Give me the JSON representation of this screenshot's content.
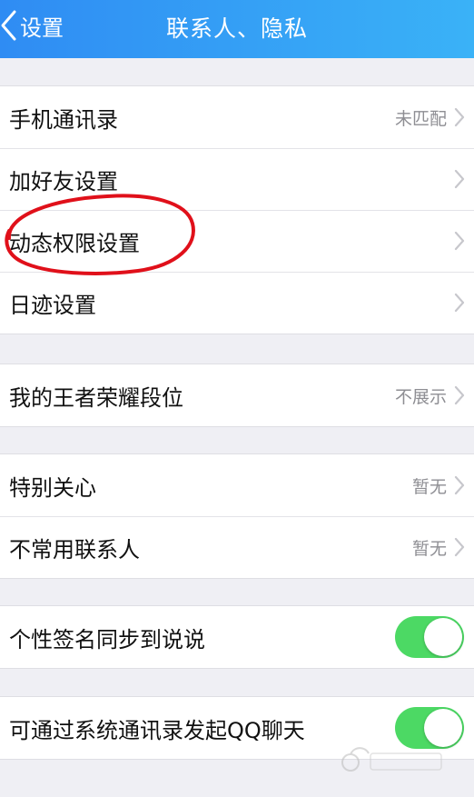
{
  "navbar": {
    "back_label": "设置",
    "title": "联系人、隐私"
  },
  "groups": [
    {
      "rows": [
        {
          "label": "手机通讯录",
          "value": "未匹配"
        },
        {
          "label": "加好友设置",
          "value": ""
        },
        {
          "label": "动态权限设置",
          "value": ""
        },
        {
          "label": "日迹设置",
          "value": ""
        }
      ]
    },
    {
      "rows": [
        {
          "label": "我的王者荣耀段位",
          "value": "不展示"
        }
      ]
    },
    {
      "rows": [
        {
          "label": "特别关心",
          "value": "暂无"
        },
        {
          "label": "不常用联系人",
          "value": "暂无"
        }
      ]
    },
    {
      "rows": [
        {
          "label": "个性签名同步到说说",
          "toggle": true
        }
      ]
    },
    {
      "rows": [
        {
          "label": "可通过系统通讯录发起QQ聊天",
          "toggle": true
        }
      ]
    }
  ],
  "colors": {
    "navbar_start": "#2f8cf3",
    "navbar_end": "#3ab2f7",
    "toggle_on": "#4cd964",
    "annotation": "#e0101a",
    "background": "#efeff4"
  },
  "icons": {
    "back": "chevron-left-icon",
    "disclosure": "chevron-right-icon",
    "watermark": "baidu-jingyan-logo"
  }
}
